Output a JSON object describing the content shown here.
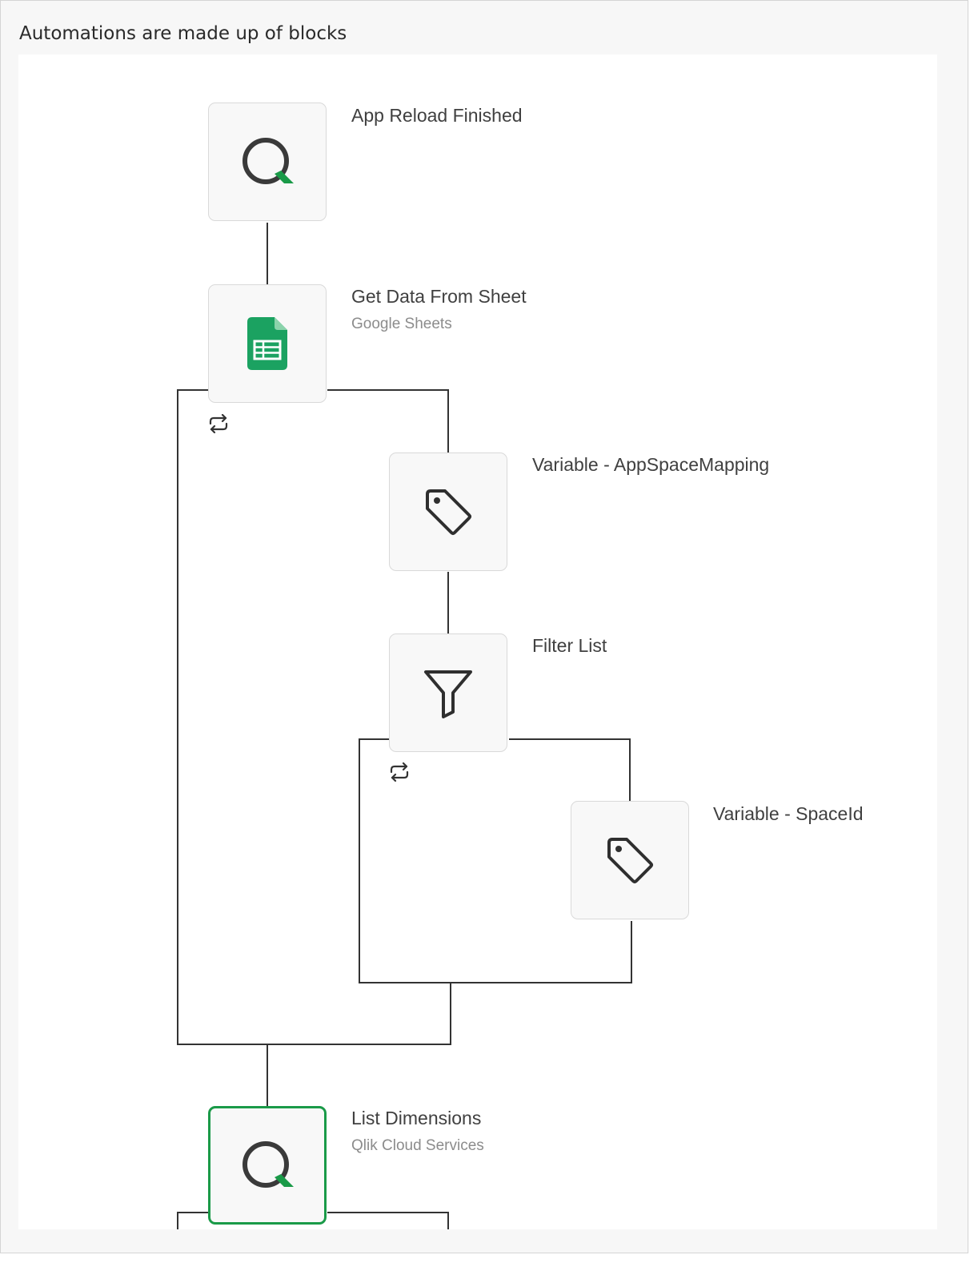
{
  "caption": "Automations are made up of blocks",
  "colors": {
    "brand_green": "#1a9a48",
    "sheets_green": "#1ba261",
    "connector": "#333333",
    "label_text": "#404040",
    "sublabel_text": "#8c8c8c"
  },
  "blocks": [
    {
      "id": "app-reload-finished",
      "title": "App Reload Finished",
      "subtitle": "",
      "icon": "qlik-icon"
    },
    {
      "id": "get-data-from-sheet",
      "title": "Get Data From Sheet",
      "subtitle": "Google Sheets",
      "icon": "google-sheets-icon"
    },
    {
      "id": "variable-appspacemapping",
      "title": "Variable - AppSpaceMapping",
      "subtitle": "",
      "icon": "tag-icon"
    },
    {
      "id": "filter-list",
      "title": "Filter List",
      "subtitle": "",
      "icon": "filter-icon"
    },
    {
      "id": "variable-spaceid",
      "title": "Variable - SpaceId",
      "subtitle": "",
      "icon": "tag-icon"
    },
    {
      "id": "list-dimensions",
      "title": "List Dimensions",
      "subtitle": "Qlik Cloud Services",
      "icon": "qlik-icon",
      "selected": true
    }
  ],
  "loop_indicators": [
    {
      "icon": "loop-icon",
      "attached_to": "get-data-from-sheet"
    },
    {
      "icon": "loop-icon",
      "attached_to": "filter-list"
    }
  ]
}
